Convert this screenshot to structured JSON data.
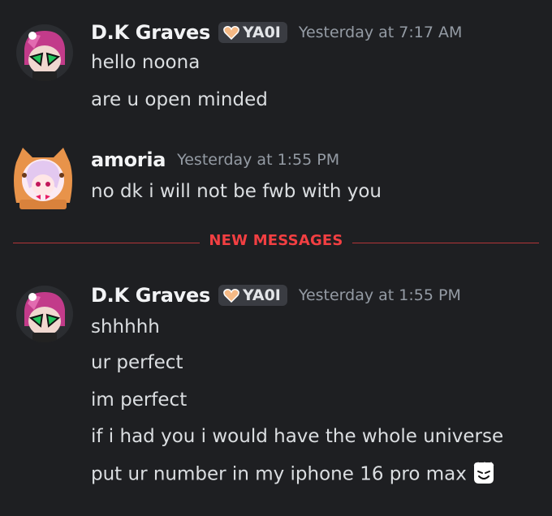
{
  "messages": [
    {
      "username": "D.K Graves",
      "tag": "YA0I",
      "timestamp": "Yesterday at 7:17 AM",
      "lines": [
        "hello noona",
        "are u open minded"
      ]
    },
    {
      "username": "amoria",
      "timestamp": "Yesterday at 1:55 PM",
      "lines": [
        "no dk i will not be fwb with you"
      ]
    },
    {
      "username": "D.K Graves",
      "tag": "YA0I",
      "timestamp": "Yesterday at 1:55 PM",
      "lines": [
        "shhhhh",
        "ur perfect",
        "im perfect",
        "if i had you i would have the whole universe",
        "put ur number in my iphone 16 pro max"
      ]
    }
  ],
  "divider": {
    "label": "NEW MESSAGES"
  },
  "icons": {
    "tag_icon": "heart-icon",
    "trailing_emoji": "smirking-ghost-emoji"
  },
  "colors": {
    "background": "#1e1f22",
    "new_messages_red": "#f23f42",
    "tag_heart": "#f5b985"
  }
}
